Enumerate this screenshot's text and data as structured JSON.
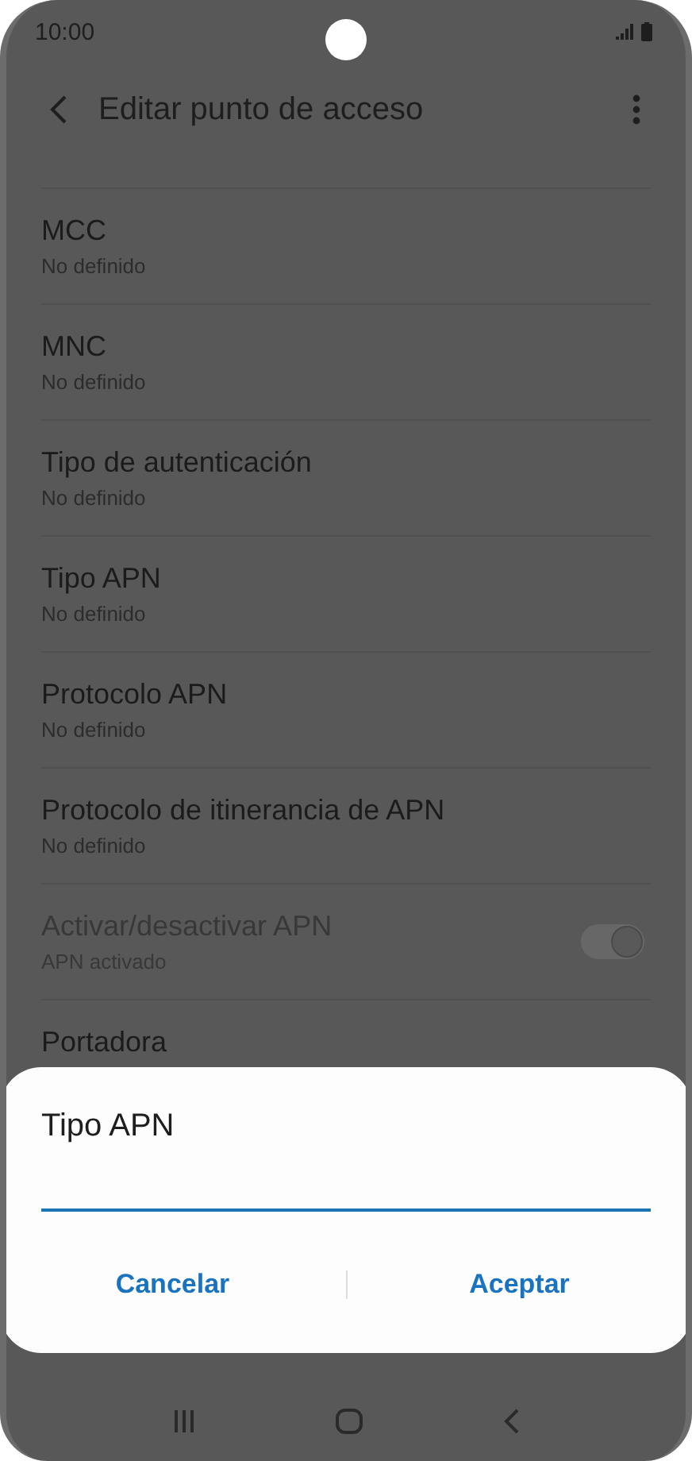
{
  "status_bar": {
    "time": "10:00"
  },
  "header": {
    "title": "Editar punto de acceso"
  },
  "items": [
    {
      "kind": "text",
      "title": "MCC",
      "subtitle": "No definido",
      "disabled": false
    },
    {
      "kind": "text",
      "title": "MNC",
      "subtitle": "No definido",
      "disabled": false
    },
    {
      "kind": "text",
      "title": "Tipo de autenticación",
      "subtitle": "No definido",
      "disabled": false
    },
    {
      "kind": "text",
      "title": "Tipo APN",
      "subtitle": "No definido",
      "disabled": false
    },
    {
      "kind": "text",
      "title": "Protocolo APN",
      "subtitle": "No definido",
      "disabled": false
    },
    {
      "kind": "text",
      "title": "Protocolo de itinerancia de APN",
      "subtitle": "No definido",
      "disabled": false
    },
    {
      "kind": "switch",
      "title": "Activar/desactivar APN",
      "subtitle": "APN activado",
      "disabled": true,
      "on": true
    },
    {
      "kind": "text",
      "title": "Portadora",
      "disabled": false
    }
  ],
  "dialog": {
    "title": "Tipo APN",
    "buttons": [
      "Cancelar",
      "Aceptar"
    ]
  }
}
